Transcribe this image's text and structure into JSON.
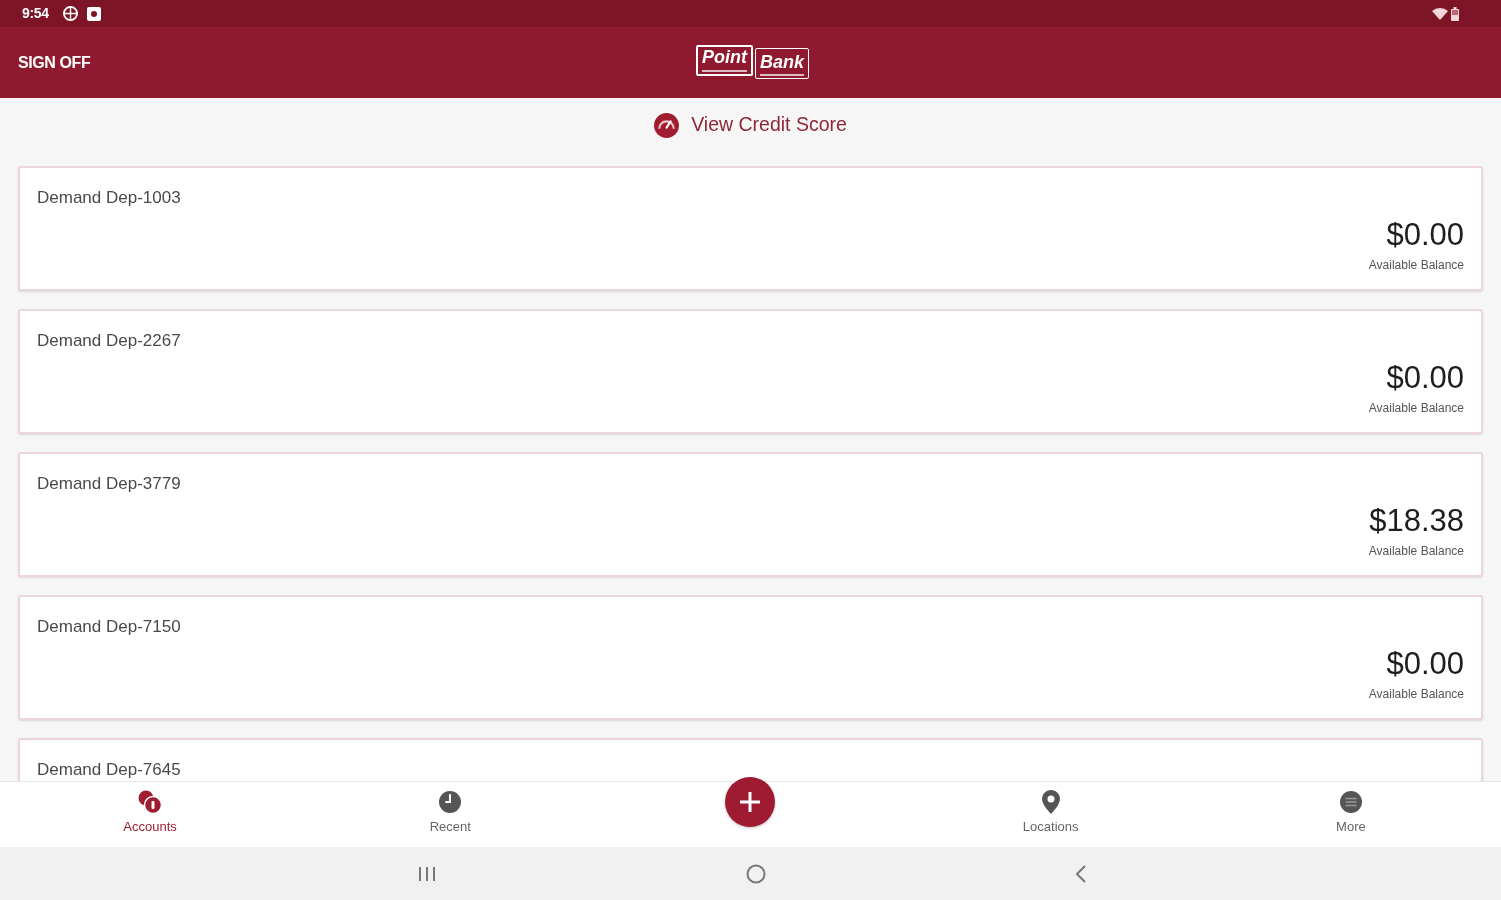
{
  "status_bar": {
    "time": "9:54"
  },
  "header": {
    "action": "SIGN OFF",
    "logo": {
      "word_1": "Point",
      "word_2": "Bank"
    }
  },
  "credit_link": {
    "label": "View Credit Score"
  },
  "accounts": [
    {
      "name": "Demand Dep-1003",
      "balance": "$0.00",
      "balance_label": "Available Balance"
    },
    {
      "name": "Demand Dep-2267",
      "balance": "$0.00",
      "balance_label": "Available Balance"
    },
    {
      "name": "Demand Dep-3779",
      "balance": "$18.38",
      "balance_label": "Available Balance"
    },
    {
      "name": "Demand Dep-7150",
      "balance": "$0.00",
      "balance_label": "Available Balance"
    },
    {
      "name": "Demand Dep-7645"
    }
  ],
  "bottom_nav": [
    {
      "kind": "tab",
      "label": "Accounts",
      "selected": true
    },
    {
      "kind": "tab",
      "label": "Recent",
      "selected": false
    },
    {
      "kind": "add"
    },
    {
      "kind": "tab",
      "label": "Locations",
      "selected": false
    },
    {
      "kind": "tab",
      "label": "More",
      "selected": false
    }
  ]
}
